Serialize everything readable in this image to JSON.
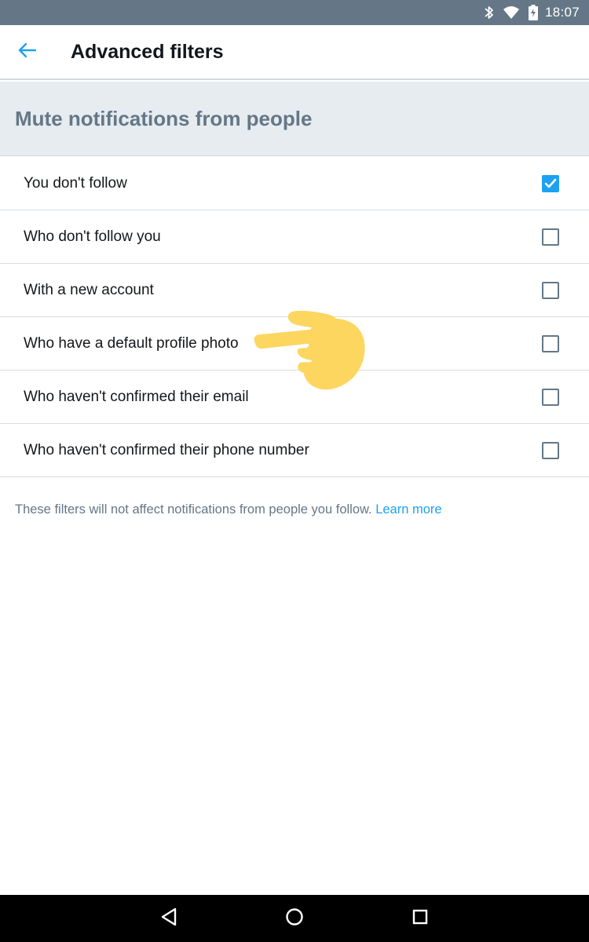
{
  "status_bar": {
    "time": "18:07",
    "icons": [
      "bluetooth-icon",
      "wifi-icon",
      "battery-icon"
    ],
    "background": "#657786"
  },
  "app_bar": {
    "title": "Advanced filters",
    "back_icon": "arrow-left-icon",
    "accent": "#1da1f2"
  },
  "section": {
    "title": "Mute notifications from people"
  },
  "filters": [
    {
      "label": "You don't follow",
      "checked": true
    },
    {
      "label": "Who don't follow you",
      "checked": false
    },
    {
      "label": "With a new account",
      "checked": false
    },
    {
      "label": "Who have a default profile photo",
      "checked": false
    },
    {
      "label": "Who haven't confirmed their email",
      "checked": false
    },
    {
      "label": "Who haven't confirmed their phone number",
      "checked": false
    }
  ],
  "footer": {
    "note": "These filters will not affect notifications from people you follow.",
    "link": "Learn more"
  },
  "overlay": {
    "icon": "pointing-hand-icon",
    "color": "#fdd660"
  },
  "nav_bar": {
    "icons": [
      "back-triangle-icon",
      "home-circle-icon",
      "recents-square-icon"
    ]
  }
}
